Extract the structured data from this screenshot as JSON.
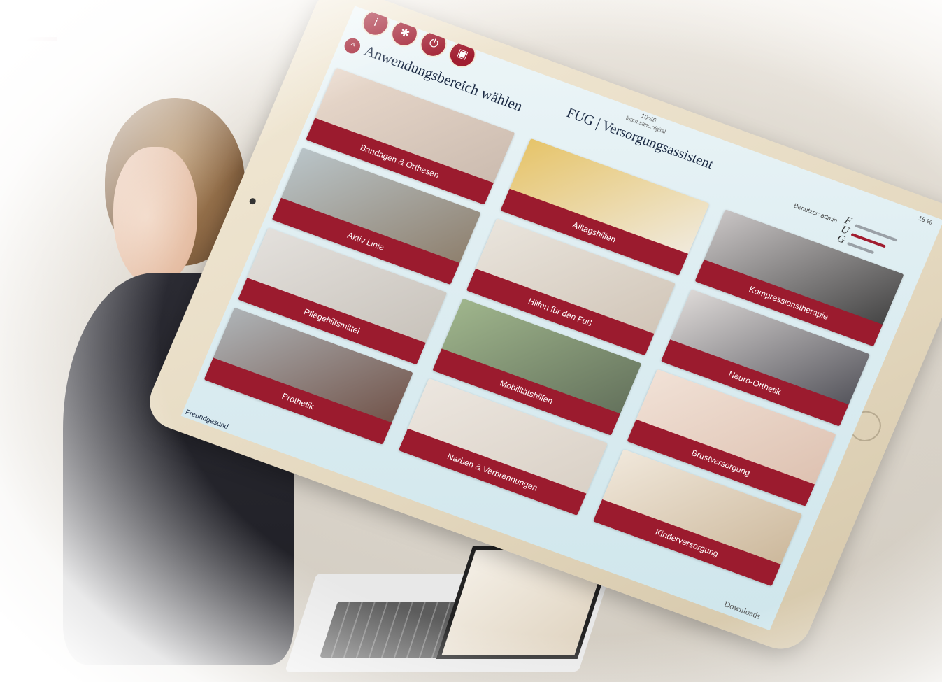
{
  "header": {
    "accent_color": "#9b1b2e"
  },
  "app": {
    "clock": "10:46",
    "host": "fugm.sanc.digital",
    "title": "FUG | Versorgungsassistent",
    "user_label": "Benutzer: admin",
    "battery": "15 %",
    "logo_letters": [
      "F",
      "U",
      "G"
    ],
    "section_title": "Anwendungsbereich wählen",
    "back_icon": "chevron-up-icon",
    "top_icons": [
      "info-icon",
      "settings-icon",
      "power-icon",
      "screen-icon"
    ],
    "footer_left": "Freundgesund",
    "footer_right": "Downloads",
    "accent_color": "#a11d30"
  },
  "tiles": [
    {
      "label": "Bandagen & Orthesen",
      "colors": [
        "#e9d9cc",
        "#c9b9ad"
      ]
    },
    {
      "label": "Alltagshilfen",
      "colors": [
        "#e6c46a",
        "#f1ede6"
      ]
    },
    {
      "label": "Kompressionstherapie",
      "colors": [
        "#c8c4c4",
        "#3a3a3a"
      ]
    },
    {
      "label": "Aktiv Linie",
      "colors": [
        "#b9c4c8",
        "#8b7a66"
      ]
    },
    {
      "label": "Hilfen für den Fuß",
      "colors": [
        "#e9e4dc",
        "#cfc3b5"
      ]
    },
    {
      "label": "Neuro-Orthetik",
      "colors": [
        "#dcd8d6",
        "#4a4a52"
      ]
    },
    {
      "label": "Pflegehilfsmittel",
      "colors": [
        "#e3e0dc",
        "#c6c0b8"
      ]
    },
    {
      "label": "Mobilitätshilfen",
      "colors": [
        "#9fb58c",
        "#5f6c58"
      ]
    },
    {
      "label": "Brustversorgung",
      "colors": [
        "#f1e1d6",
        "#dcbfae"
      ]
    },
    {
      "label": "Prothetik",
      "colors": [
        "#aeb3b6",
        "#6d4c41"
      ]
    },
    {
      "label": "Narben & Verbrennungen",
      "colors": [
        "#ece6df",
        "#d8cfc4"
      ]
    },
    {
      "label": "Kinderversorgung",
      "colors": [
        "#f0e7da",
        "#c9b496"
      ]
    }
  ]
}
